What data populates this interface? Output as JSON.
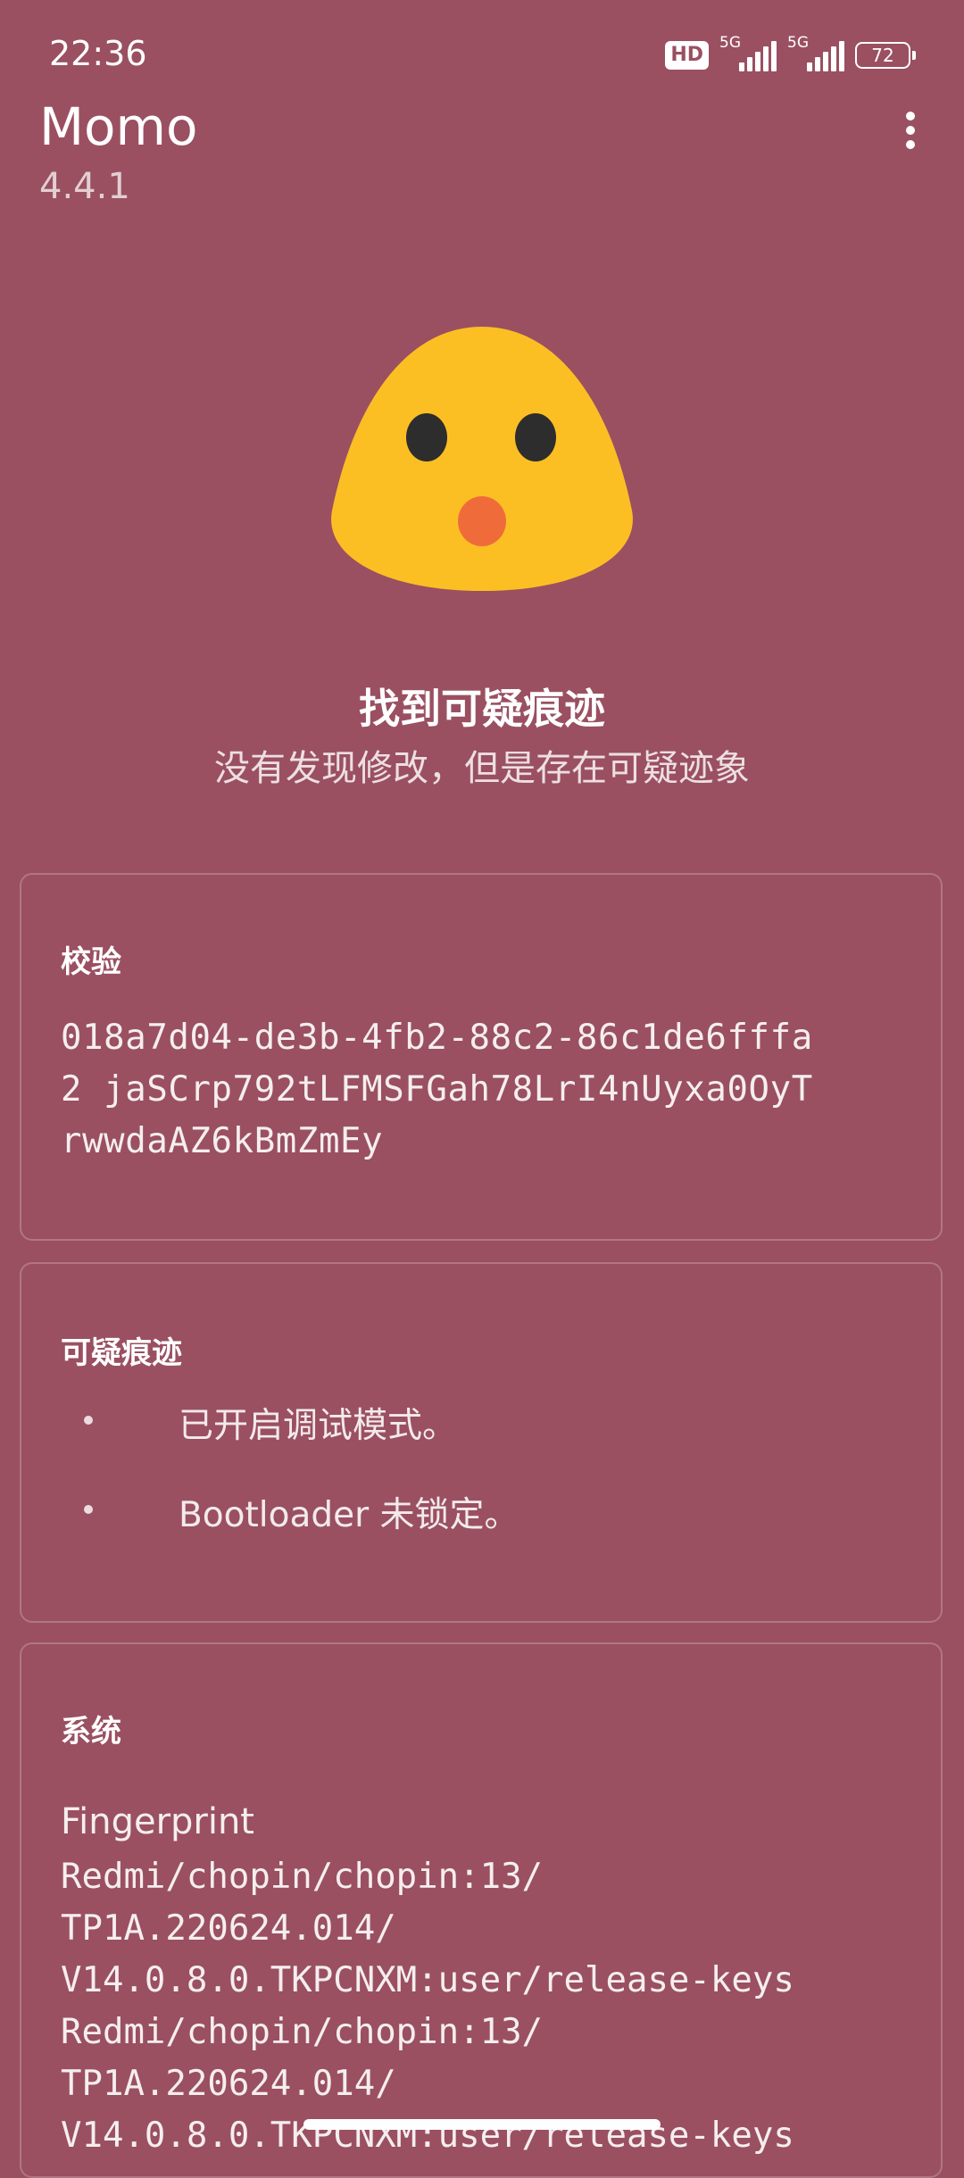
{
  "status_bar": {
    "time": "22:36",
    "hd_badge": "HD",
    "network_label": "5G",
    "battery": "72"
  },
  "header": {
    "title": "Momo",
    "version": "4.4.1",
    "menu_icon": "more-vert-icon"
  },
  "result": {
    "icon": "surprised-face-icon",
    "title": "找到可疑痕迹",
    "subtitle": "没有发现修改，但是存在可疑迹象"
  },
  "verification": {
    "title": "校验",
    "lines": [
      "018a7d04-de3b-4fb2-88c2-86c1de6fffa",
      "2 jaSCrp792tLFMSFGah78LrI4nUyxa0OyT",
      "rwwdaAZ6kBmZmEy"
    ]
  },
  "suspicious": {
    "title": "可疑痕迹",
    "items": [
      "已开启调试模式。",
      "Bootloader 未锁定。"
    ]
  },
  "system": {
    "title": "系统",
    "fingerprint_label": "Fingerprint",
    "fingerprint_lines": [
      "Redmi/chopin/chopin:13/",
      "TP1A.220624.014/",
      "V14.0.8.0.TKPCNXM:user/release-keys",
      "Redmi/chopin/chopin:13/",
      "TP1A.220624.014/",
      "V14.0.8.0.TKPCNXM:user/release-keys"
    ]
  },
  "colors": {
    "background": "#9a5061",
    "emoji_face": "#fbbf24",
    "emoji_eyes": "#2d2d2d",
    "emoji_mouth": "#f06b3a"
  }
}
